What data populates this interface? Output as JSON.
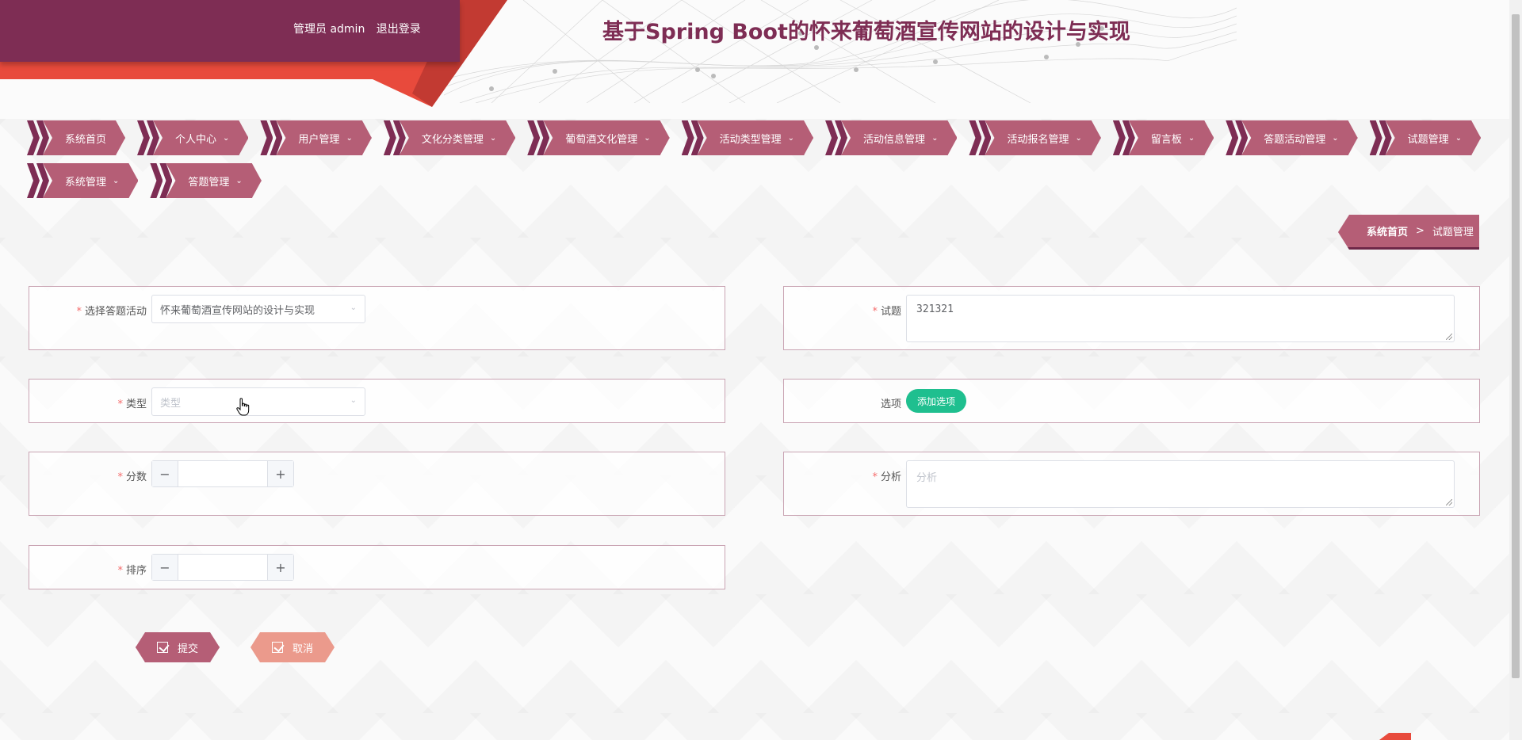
{
  "header": {
    "user_role": "管理员 admin",
    "logout": "退出登录",
    "title": "基于Spring Boot的怀来葡萄酒宣传网站的设计与实现"
  },
  "nav": {
    "row1": [
      {
        "label": "系统首页",
        "dropdown": false
      },
      {
        "label": "个人中心",
        "dropdown": true
      },
      {
        "label": "用户管理",
        "dropdown": true
      },
      {
        "label": "文化分类管理",
        "dropdown": true
      },
      {
        "label": "葡萄酒文化管理",
        "dropdown": true
      },
      {
        "label": "活动类型管理",
        "dropdown": true
      },
      {
        "label": "活动信息管理",
        "dropdown": true
      },
      {
        "label": "活动报名管理",
        "dropdown": true
      },
      {
        "label": "留言板",
        "dropdown": true
      },
      {
        "label": "答题活动管理",
        "dropdown": true
      },
      {
        "label": "试题管理",
        "dropdown": true
      }
    ],
    "row2": [
      {
        "label": "系统管理",
        "dropdown": true
      },
      {
        "label": "答题管理",
        "dropdown": true
      }
    ]
  },
  "breadcrumb": {
    "home": "系统首页",
    "separator": ">",
    "current": "试题管理"
  },
  "form": {
    "activity": {
      "label": "选择答题活动",
      "value": "怀来葡萄酒宣传网站的设计与实现",
      "required": true
    },
    "question": {
      "label": "试题",
      "value": "321321",
      "required": true
    },
    "type": {
      "label": "类型",
      "placeholder": "类型",
      "required": true
    },
    "options": {
      "label": "选项",
      "add_button": "添加选项"
    },
    "score": {
      "label": "分数",
      "value": "",
      "required": true
    },
    "analysis": {
      "label": "分析",
      "placeholder": "分析",
      "required": true
    },
    "sort": {
      "label": "排序",
      "value": "",
      "required": true
    }
  },
  "actions": {
    "submit": "提交",
    "cancel": "取消"
  },
  "colors": {
    "brand": "#7e2d54",
    "nav_item": "#b55e76",
    "accent_red": "#e84a3c",
    "success": "#1fbf8f",
    "cancel": "#eb9a8c"
  },
  "stepper": {
    "minus": "−",
    "plus": "+"
  },
  "caret": "⌄"
}
